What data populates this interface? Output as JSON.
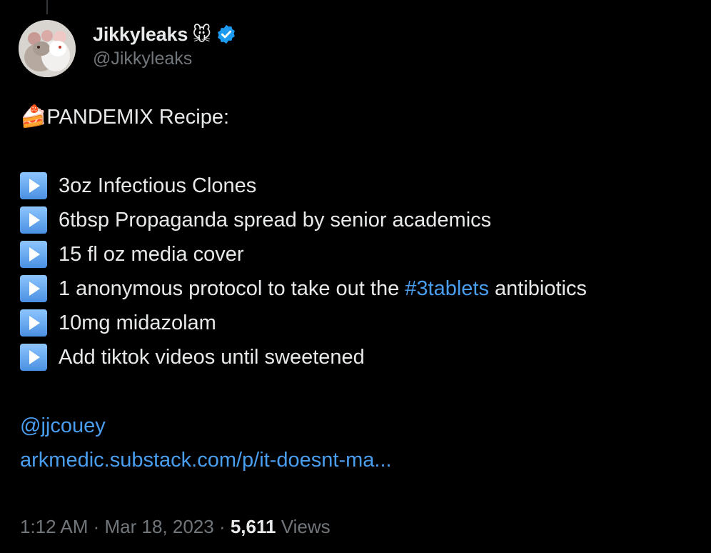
{
  "author": {
    "display_name": "Jikkyleaks",
    "name_emoji": "🐭",
    "handle": "@Jikkyleaks",
    "verified_color": "#1d9bf0"
  },
  "tweet": {
    "title_emoji": "🍰",
    "title": "PANDEMIX Recipe:",
    "items": [
      "3oz Infectious Clones",
      "6tbsp Propaganda spread by senior academics",
      "15 fl oz media cover",
      "1 anonymous protocol to take out the ",
      "10mg midazolam",
      "Add tiktok videos until sweetened"
    ],
    "item4_hashtag": "#3tablets",
    "item4_suffix": " antibiotics",
    "mention": "@jjcouey",
    "link": "arkmedic.substack.com/p/it-doesnt-ma..."
  },
  "meta": {
    "time": "1:12 AM",
    "separator": " · ",
    "date": "Mar 18, 2023",
    "views_count": "5,611",
    "views_label": " Views"
  },
  "colors": {
    "background": "#000000",
    "text": "#e7e9ea",
    "secondary": "#71767b",
    "link": "#1d9bf0"
  }
}
